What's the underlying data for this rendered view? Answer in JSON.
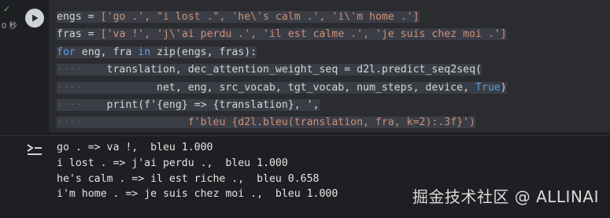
{
  "status": {
    "check_glyph": "✓",
    "exec_time": "0 秒"
  },
  "icons": {
    "run": "play-icon",
    "output": "output-expand-icon",
    "check": "check-icon"
  },
  "code": {
    "line1": {
      "a": "engs",
      "b": "=",
      "c": "['go .', \"i lost .\", 'he\\'s calm .', 'i\\'m home .']"
    },
    "line2": {
      "a": "fras",
      "b": "=",
      "c": "['va !', 'j\\'ai perdu .', 'il est calme .', 'je suis chez moi .']"
    },
    "line3": {
      "kw1": "for",
      "vars": "eng, fra",
      "kw2": "in",
      "rest": "zip(engs, fras):"
    },
    "line4": {
      "a": "translation, dec_attention_weight_seq",
      "b": "=",
      "c": "d2l.predict_seq2seq("
    },
    "line5": {
      "a": "net, eng, src_vocab, tgt_vocab, num_steps, device,",
      "b": "True",
      "c": ")"
    },
    "line6": {
      "a": "print(f'{eng}",
      "b": "=>",
      "c": "{translation}, ',"
    },
    "line7": {
      "a": "f'bleu {d2l.bleu(translation, fra, k=2):.3f}')"
    }
  },
  "output": {
    "lines": [
      "go . => va !,  bleu 1.000",
      "i lost . => j'ai perdu .,  bleu 1.000",
      "he's calm . => il est riche .,  bleu 0.658",
      "i'm home . => je suis chez moi .,  bleu 1.000"
    ]
  },
  "watermark": "掘金技术社区 @ ALLINAI",
  "colors": {
    "background": "#1e1f22",
    "code_bg": "#2b2c30",
    "keyword": "#5f9df0",
    "string": "#ce9178",
    "success": "#5fb760"
  }
}
